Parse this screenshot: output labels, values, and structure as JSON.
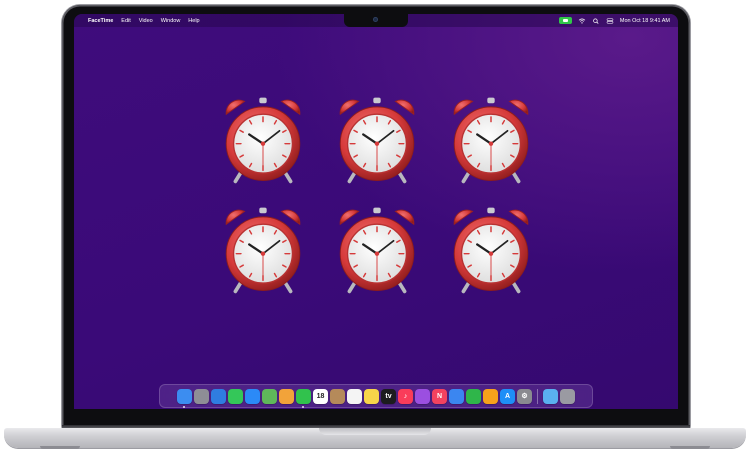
{
  "menubar": {
    "apple_glyph": "",
    "app_name": "FaceTime",
    "menus": [
      "Edit",
      "Video",
      "Window",
      "Help"
    ],
    "datetime": "Mon Oct 18  9:41 AM"
  },
  "desktop": {
    "clock_count": 6,
    "colors": {
      "wallpaper": "#3d0b7a",
      "clock_red": "#d63a3a",
      "dock_bg": "#7850aa"
    }
  },
  "dock": {
    "apps": [
      {
        "name": "finder-icon",
        "label": "",
        "color": "#3c8df0"
      },
      {
        "name": "launchpad-icon",
        "label": "",
        "color": "#8e8e96"
      },
      {
        "name": "safari-icon",
        "label": "",
        "color": "#2f7de0"
      },
      {
        "name": "messages-icon",
        "label": "",
        "color": "#34c759"
      },
      {
        "name": "mail-icon",
        "label": "",
        "color": "#2b8af7"
      },
      {
        "name": "maps-icon",
        "label": "",
        "color": "#5fb85a"
      },
      {
        "name": "photos-icon",
        "label": "",
        "color": "#f2a33a"
      },
      {
        "name": "facetime-icon",
        "label": "",
        "color": "#31c24d"
      },
      {
        "name": "calendar-icon",
        "label": "18",
        "color": "#ffffff"
      },
      {
        "name": "contacts-icon",
        "label": "",
        "color": "#b58a5a"
      },
      {
        "name": "reminders-icon",
        "label": "",
        "color": "#f4f4f4"
      },
      {
        "name": "notes-icon",
        "label": "",
        "color": "#f7d54a"
      },
      {
        "name": "tv-icon",
        "label": "tv",
        "color": "#1c1c1e"
      },
      {
        "name": "music-icon",
        "label": "♪",
        "color": "#fa3c5a"
      },
      {
        "name": "podcasts-icon",
        "label": "",
        "color": "#9b4fe0"
      },
      {
        "name": "news-icon",
        "label": "N",
        "color": "#f3425f"
      },
      {
        "name": "keynote-icon",
        "label": "",
        "color": "#3b86f0"
      },
      {
        "name": "numbers-icon",
        "label": "",
        "color": "#2fb64a"
      },
      {
        "name": "pages-icon",
        "label": "",
        "color": "#f7a21b"
      },
      {
        "name": "app-store-icon",
        "label": "A",
        "color": "#1e8ef7"
      },
      {
        "name": "system-preferences-icon",
        "label": "⚙",
        "color": "#8a8a90"
      }
    ],
    "trailing": [
      {
        "name": "downloads-folder-icon",
        "label": "",
        "color": "#5ab0f0"
      },
      {
        "name": "trash-icon",
        "label": "",
        "color": "#9a9aa2"
      }
    ]
  }
}
